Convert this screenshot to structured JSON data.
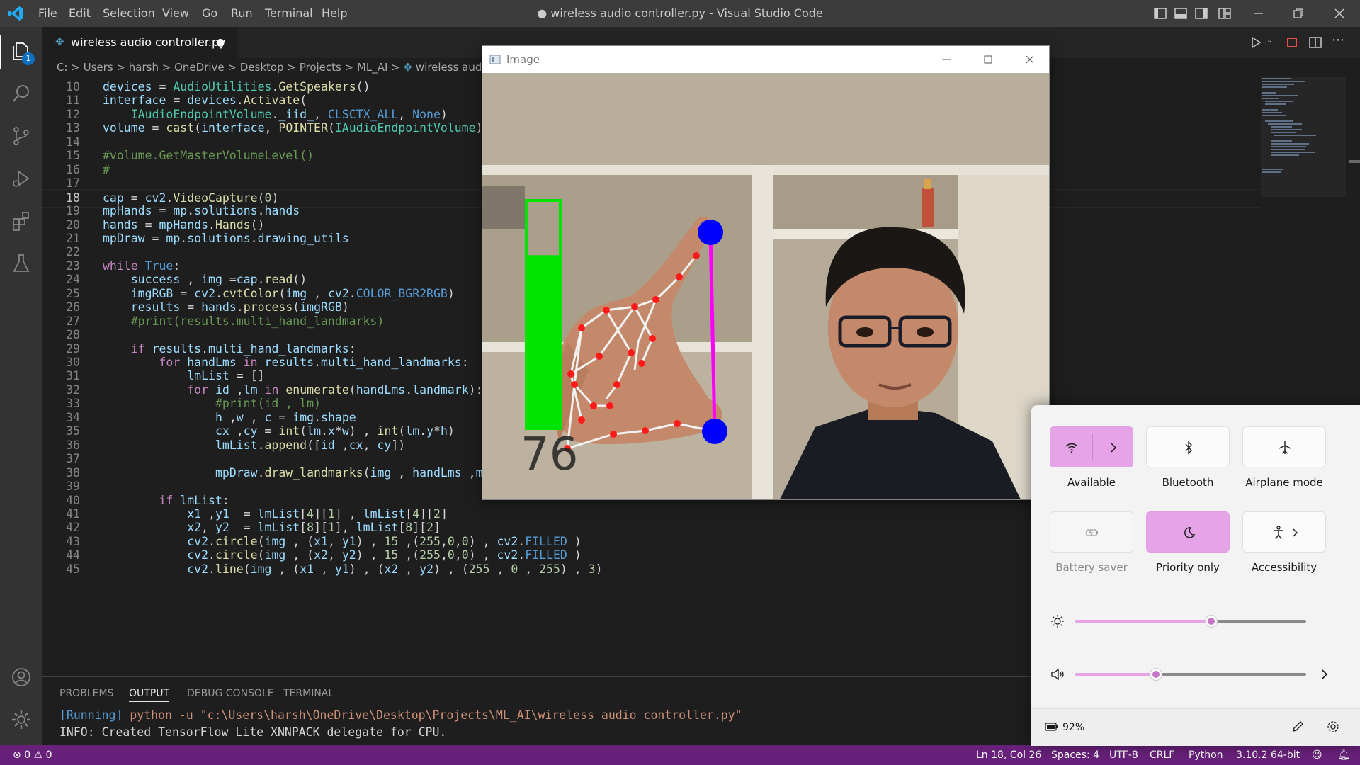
{
  "app": {
    "window_title": "● wireless audio controller.py - Visual Studio Code",
    "menu": [
      "File",
      "Edit",
      "Selection",
      "View",
      "Go",
      "Run",
      "Terminal",
      "Help"
    ],
    "explorer_badge": "1"
  },
  "editor": {
    "tab_label": "wireless audio controller.py",
    "tab_dirty_marker": "●",
    "breadcrumb": [
      "C:",
      "Users",
      "harsh",
      "OneDrive",
      "Desktop",
      "Projects",
      "ML_AI",
      "wireless audio c"
    ],
    "breadcrumb_separator": ">",
    "lines": [
      {
        "n": "10",
        "text": "devices = AudioUtilities.GetSpeakers()"
      },
      {
        "n": "11",
        "text": "interface = devices.Activate("
      },
      {
        "n": "12",
        "text": "    IAudioEndpointVolume._iid_, CLSCTX_ALL, None)"
      },
      {
        "n": "13",
        "text": "volume = cast(interface, POINTER(IAudioEndpointVolume))"
      },
      {
        "n": "14",
        "text": ""
      },
      {
        "n": "15",
        "text": "#volume.GetMasterVolumeLevel()"
      },
      {
        "n": "16",
        "text": "#"
      },
      {
        "n": "17",
        "text": ""
      },
      {
        "n": "18",
        "text": "cap = cv2.VideoCapture(0)"
      },
      {
        "n": "19",
        "text": "mpHands = mp.solutions.hands"
      },
      {
        "n": "20",
        "text": "hands = mpHands.Hands()"
      },
      {
        "n": "21",
        "text": "mpDraw = mp.solutions.drawing_utils"
      },
      {
        "n": "22",
        "text": ""
      },
      {
        "n": "23",
        "text": "while True:"
      },
      {
        "n": "24",
        "text": "    success , img =cap.read()"
      },
      {
        "n": "25",
        "text": "    imgRGB = cv2.cvtColor(img , cv2.COLOR_BGR2RGB)"
      },
      {
        "n": "26",
        "text": "    results = hands.process(imgRGB)"
      },
      {
        "n": "27",
        "text": "    #print(results.multi_hand_landmarks)"
      },
      {
        "n": "28",
        "text": ""
      },
      {
        "n": "29",
        "text": "    if results.multi_hand_landmarks:"
      },
      {
        "n": "30",
        "text": "        for handLms in results.multi_hand_landmarks:"
      },
      {
        "n": "31",
        "text": "            lmList = []"
      },
      {
        "n": "32",
        "text": "            for id ,lm in enumerate(handLms.landmark):"
      },
      {
        "n": "33",
        "text": "                #print(id , lm)"
      },
      {
        "n": "34",
        "text": "                h ,w , c = img.shape"
      },
      {
        "n": "35",
        "text": "                cx ,cy = int(lm.x*w) , int(lm.y*h)"
      },
      {
        "n": "36",
        "text": "                lmList.append([id ,cx, cy])"
      },
      {
        "n": "37",
        "text": ""
      },
      {
        "n": "38",
        "text": "                mpDraw.draw_landmarks(img , handLms ,mpHands.HAND_CONNECTIONS)"
      },
      {
        "n": "39",
        "text": ""
      },
      {
        "n": "40",
        "text": "        if lmList:"
      },
      {
        "n": "41",
        "text": "            x1 ,y1  = lmList[4][1] , lmList[4][2]"
      },
      {
        "n": "42",
        "text": "            x2, y2  = lmList[8][1], lmList[8][2]"
      },
      {
        "n": "43",
        "text": "            cv2.circle(img , (x1, y1) , 15 ,(255,0,0) , cv2.FILLED )"
      },
      {
        "n": "44",
        "text": "            cv2.circle(img , (x2, y2) , 15 ,(255,0,0) , cv2.FILLED )"
      },
      {
        "n": "45",
        "text": "            cv2.line(img , (x1 , y1) , (x2 , y2) , (255 , 0 , 255) , 3)"
      }
    ],
    "current_line": "18"
  },
  "panel": {
    "tabs": [
      "PROBLEMS",
      "OUTPUT",
      "DEBUG CONSOLE",
      "TERMINAL"
    ],
    "active_tab": "OUTPUT",
    "output_running": "[Running]",
    "output_command": " python -u \"c:\\Users\\harsh\\OneDrive\\Desktop\\Projects\\ML_AI\\wireless audio controller.py\"",
    "output_info": "INFO: Created TensorFlow Lite XNNPACK delegate for CPU."
  },
  "statusbar": {
    "errors": "0",
    "warnings": "0",
    "position": "Ln 18, Col 26",
    "spaces": "Spaces: 4",
    "encoding": "UTF-8",
    "eol": "CRLF",
    "language": "Python",
    "interpreter": "3.10.2 64-bit"
  },
  "image_window": {
    "title": "Image",
    "volume_overlay_text": "76",
    "volume_bar_level": 0.76,
    "colors": {
      "bar": "#00e400",
      "line": "#ff00ff",
      "tip": "#0000ff",
      "landmark": "#ff0000"
    }
  },
  "quick_settings": {
    "tiles": [
      {
        "label": "Available",
        "icon": "wifi-icon",
        "on": true
      },
      {
        "label": "Bluetooth",
        "icon": "bluetooth-icon",
        "on": false
      },
      {
        "label": "Airplane mode",
        "icon": "airplane-icon",
        "on": false
      },
      {
        "label": "Battery saver",
        "icon": "battery-saver-icon",
        "on": false,
        "disabled": true
      },
      {
        "label": "Priority only",
        "icon": "moon-icon",
        "on": true
      },
      {
        "label": "Accessibility",
        "icon": "accessibility-icon",
        "on": false
      }
    ],
    "brightness_level": 0.59,
    "volume_level": 0.35,
    "battery": "92%",
    "accent": "#e7a3e7"
  }
}
